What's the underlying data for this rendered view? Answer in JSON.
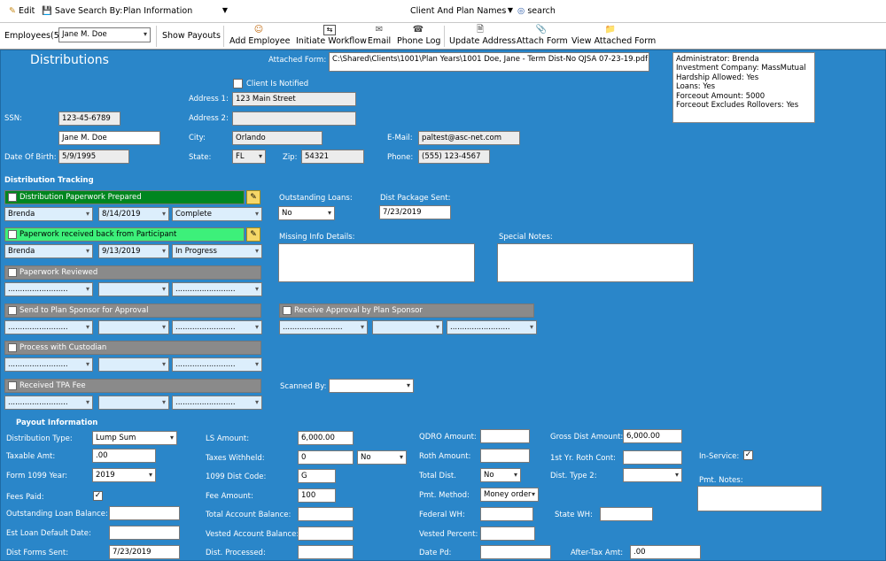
{
  "toolbar1": {
    "edit": "Edit",
    "save": "Save",
    "search_by_label": "Search By:",
    "search_by_value": "Plan Information",
    "client_filter": "Client And Plan Names",
    "search": "search"
  },
  "toolbar2": {
    "employees_label": "Employees(5)",
    "employee_value": "Jane M. Doe",
    "show_payouts": "Show Payouts",
    "add_employee": "Add Employee",
    "initiate_workflow": "Initiate Workflow",
    "email": "Email",
    "phone_log": "Phone Log",
    "update_address": "Update Address",
    "attach_form": "Attach Form",
    "view_attached_form": "View Attached Form"
  },
  "form": {
    "title": "Distributions",
    "attached_form_label": "Attached Form:",
    "attached_form_value": "C:\\Shared\\Clients\\1001\\Plan Years\\1001 Doe, Jane - Term Dist-No QJSA 07-23-19.pdf",
    "info_lines": [
      "Administrator: Brenda",
      "Investment Company: MassMutual",
      "Hardship Allowed: Yes",
      "Loans: Yes",
      "Forceout Amount: 5000",
      "Forceout Excludes Rollovers: Yes"
    ],
    "client_notified": "Client Is Notified",
    "address1_label": "Address 1:",
    "address1": "123 Main Street",
    "address2_label": "Address 2:",
    "address2": "",
    "ssn_label": "SSN:",
    "ssn": "123-45-6789",
    "name": "Jane M. Doe",
    "city_label": "City:",
    "city": "Orlando",
    "email_label": "E-Mail:",
    "email": "paltest@asc-net.com",
    "dob_label": "Date Of Birth:",
    "dob": "5/9/1995",
    "state_label": "State:",
    "state": "FL",
    "zip_label": "Zip:",
    "zip": "54321",
    "phone_label": "Phone:",
    "phone": "(555) 123-4567"
  },
  "tracking": {
    "header": "Distribution Tracking",
    "dots": ".........................",
    "steps": [
      {
        "label": "Distribution Paperwork Prepared",
        "checked": "✓",
        "person": "Brenda",
        "date": "8/14/2019",
        "status": "Complete"
      },
      {
        "label": "Paperwork received back from Participant",
        "checked": "",
        "person": "Brenda",
        "date": "9/13/2019",
        "status": "In Progress"
      },
      {
        "label": "Paperwork Reviewed",
        "checked": ""
      },
      {
        "label": "Send to Plan Sponsor for Approval",
        "checked": ""
      },
      {
        "label": "Process with Custodian",
        "checked": ""
      },
      {
        "label": "Received TPA Fee",
        "checked": ""
      }
    ],
    "receive_approval": "Receive Approval by Plan Sponsor",
    "outstanding_loans_label": "Outstanding Loans:",
    "outstanding_loans": "No",
    "dist_package_label": "Dist Package Sent:",
    "dist_package": "7/23/2019",
    "missing_info_label": "Missing Info Details:",
    "special_notes_label": "Special Notes:",
    "scanned_by_label": "Scanned By:"
  },
  "payout": {
    "header": "Payout Information",
    "distribution_type_label": "Distribution Type:",
    "distribution_type": "Lump Sum",
    "taxable_amt_label": "Taxable Amt:",
    "taxable_amt": ".00",
    "form_1099_year_label": "Form 1099 Year:",
    "form_1099_year": "2019",
    "fees_paid_label": "Fees Paid:",
    "fees_paid": "✓",
    "outstanding_loan_balance_label": "Outstanding Loan Balance:",
    "est_loan_default_label": "Est Loan Default Date:",
    "dist_forms_sent_label": "Dist Forms Sent:",
    "dist_forms_sent": "7/23/2019",
    "ls_amount_label": "LS Amount:",
    "ls_amount": "6,000.00",
    "taxes_withheld_label": "Taxes Withheld:",
    "taxes_withheld": "0",
    "taxes_withheld_flag": "No",
    "dist_code_label": "1099 Dist Code:",
    "dist_code": "G",
    "fee_amount_label": "Fee Amount:",
    "fee_amount": "100",
    "total_account_balance_label": "Total Account Balance:",
    "vested_account_balance_label": "Vested Account Balance:",
    "dist_processed_label": "Dist. Processed:",
    "qdro_amount_label": "QDRO Amount:",
    "roth_amount_label": "Roth Amount:",
    "total_dist_label": "Total Dist.",
    "total_dist": "No",
    "pmt_method_label": "Pmt. Method:",
    "pmt_method": "Money order",
    "federal_wh_label": "Federal WH:",
    "vested_percent_label": "Vested Percent:",
    "date_pd_label": "Date Pd:",
    "gross_dist_label": "Gross Dist Amount:",
    "gross_dist": "6,000.00",
    "roth_cont_label": "1st Yr. Roth Cont:",
    "dist_type2_label": "Dist. Type 2:",
    "state_wh_label": "State WH:",
    "after_tax_label": "After-Tax Amt:",
    "after_tax": ".00",
    "in_service_label": "In-Service:",
    "in_service": "✓",
    "pmt_notes_label": "Pmt. Notes:"
  }
}
